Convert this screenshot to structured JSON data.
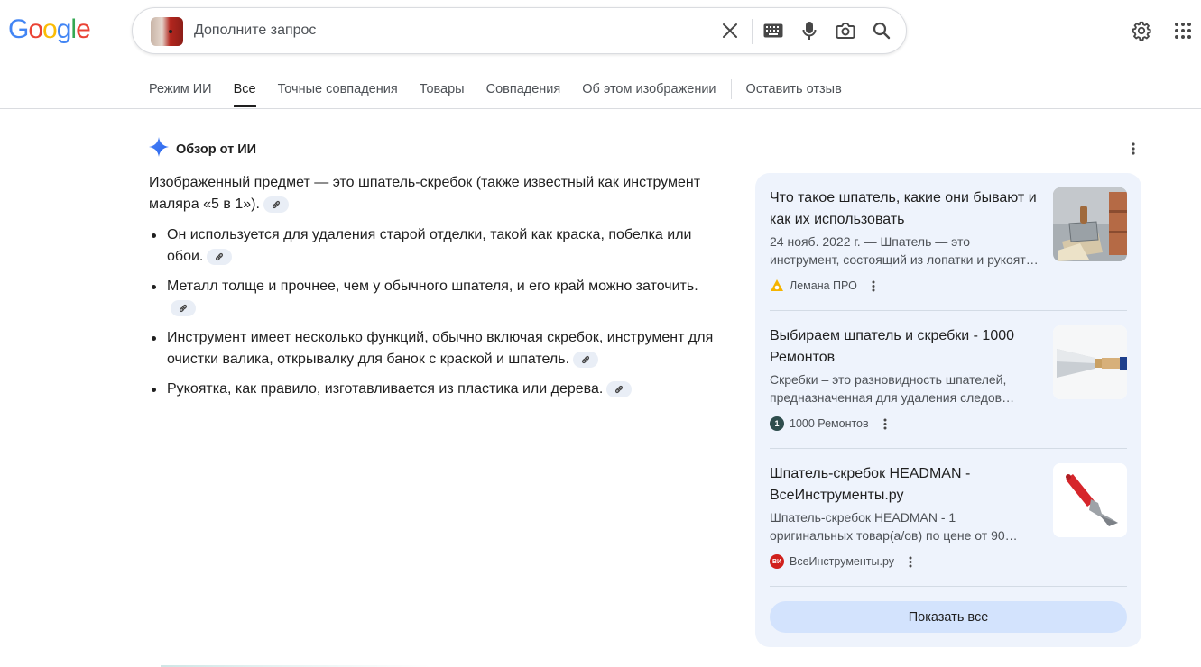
{
  "logo": {
    "letters": [
      "G",
      "o",
      "o",
      "g",
      "l",
      "e"
    ],
    "colors": [
      "#4285f4",
      "#ea4335",
      "#fbbc05",
      "#4285f4",
      "#34a853",
      "#ea4335"
    ]
  },
  "search": {
    "placeholder": "Дополните запрос",
    "value": "",
    "icons": [
      "image-thumbnail",
      "close-icon",
      "keyboard-icon",
      "mic-icon",
      "lens-icon",
      "search-icon"
    ]
  },
  "header_icons": [
    "gear-icon",
    "apps-grid-icon"
  ],
  "tabs": [
    {
      "label": "Режим ИИ",
      "active": false
    },
    {
      "label": "Все",
      "active": true
    },
    {
      "label": "Точные совпадения",
      "active": false
    },
    {
      "label": "Товары",
      "active": false
    },
    {
      "label": "Совпадения",
      "active": false
    },
    {
      "label": "Об этом изображении",
      "active": false
    },
    {
      "label": "Оставить отзыв",
      "active": false
    }
  ],
  "ai_overview": {
    "title": "Обзор от ИИ",
    "intro": "Изображенный предмет — это шпатель-скребок (также известный как инструмент маляра «5 в 1»).",
    "bullets": [
      "Он используется для удаления старой отделки, такой как краска, побелка или обои.",
      "Металл толще и прочнее, чем у обычного шпателя, и его край можно заточить.",
      "Инструмент имеет несколько функций, обычно включая скребок, инструмент для очистки валика, открывалку для банок с краской и шпатель.",
      "Рукоятка, как правило, изготавливается из пластика или дерева."
    ]
  },
  "sources": [
    {
      "title": "Что такое шпатель, какие они бывают и как их использовать",
      "snippet_line1": "24 нояб. 2022 г. — Шпатель — это",
      "snippet_line2": "инструмент, состоящий из лопатки и рукоят…",
      "site": "Лемана ПРО",
      "favicon_color": "#f5b400",
      "favicon_text": ""
    },
    {
      "title": "Выбираем шпатель и скребки - 1000 Ремонтов",
      "snippet_line1": "Скребки – это разновидность шпателей,",
      "snippet_line2": "предназначенная для удаления следов…",
      "site": "1000 Ремонтов",
      "favicon_color": "#2e4d4d",
      "favicon_text": "1"
    },
    {
      "title": "Шпатель-скребок HEADMAN - ВсеИнструменты.ру",
      "snippet_line1": "Шпатель-скребок HEADMAN - 1",
      "snippet_line2": "оригинальных товар(а/ов) по цене от 90…",
      "site": "ВсеИнструменты.ру",
      "favicon_color": "#d0201c",
      "favicon_text": "ВИ"
    }
  ],
  "show_all_label": "Показать все"
}
